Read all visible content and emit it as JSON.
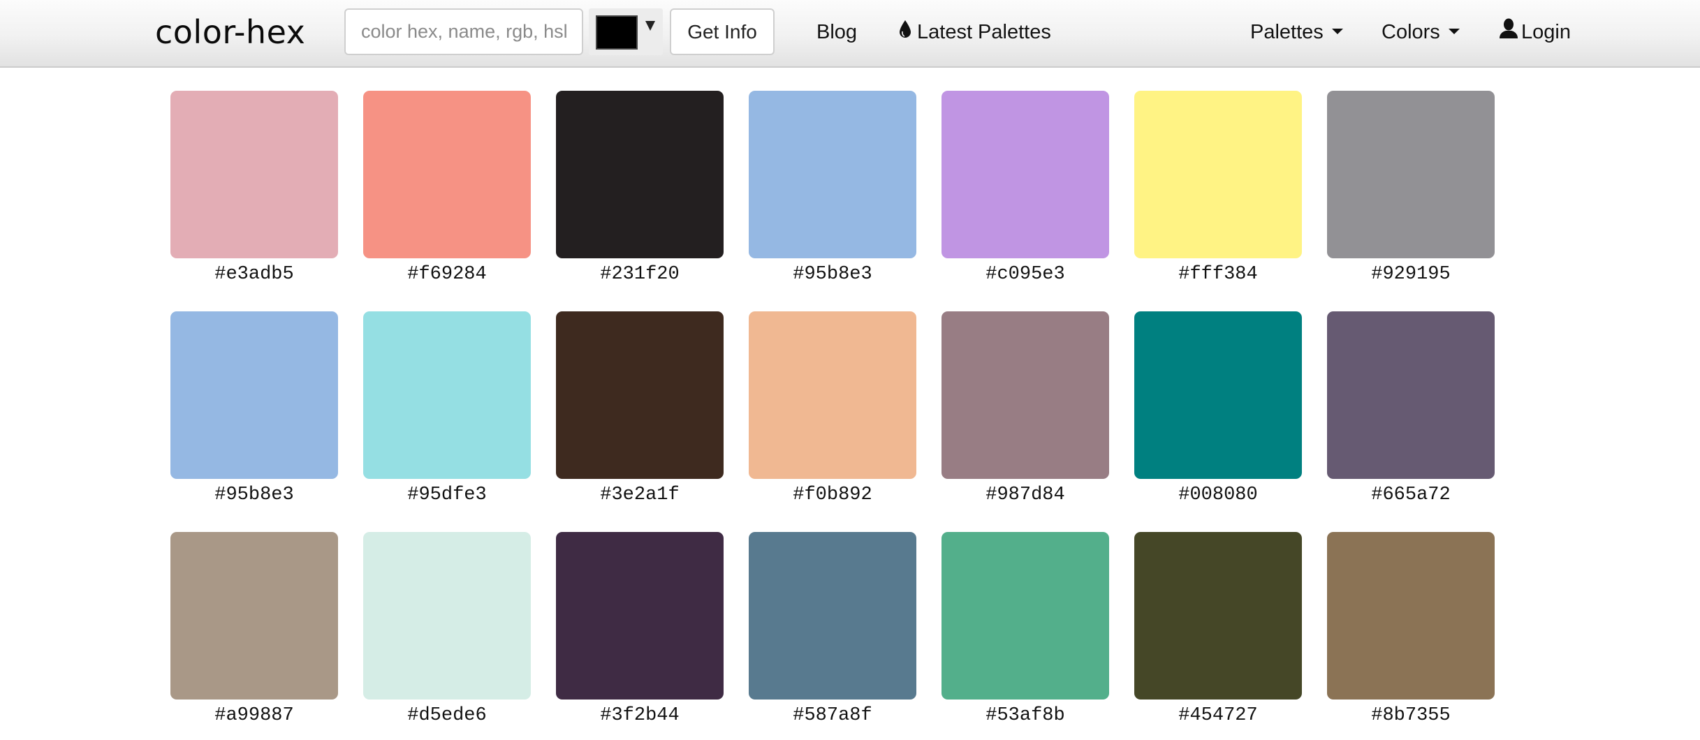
{
  "navbar": {
    "logo": "color-hex",
    "search": {
      "placeholder": "color hex, name, rgb, hsl",
      "value": ""
    },
    "color_picker": {
      "selected_color": "#000000",
      "icon": "caret-down-icon"
    },
    "get_info_label": "Get Info",
    "links": {
      "blog": "Blog",
      "latest_palettes": {
        "label": "Latest Palettes",
        "icon": "drop-icon"
      },
      "palettes": {
        "label": "Palettes",
        "icon": "caret-down-icon"
      },
      "colors": {
        "label": "Colors",
        "icon": "caret-down-icon"
      },
      "login": {
        "label": "Login",
        "icon": "user-icon"
      }
    }
  },
  "swatches": [
    {
      "hex": "#e3adb5",
      "label": "#e3adb5"
    },
    {
      "hex": "#f69284",
      "label": "#f69284"
    },
    {
      "hex": "#231f20",
      "label": "#231f20"
    },
    {
      "hex": "#95b8e3",
      "label": "#95b8e3"
    },
    {
      "hex": "#c095e3",
      "label": "#c095e3"
    },
    {
      "hex": "#fff384",
      "label": "#fff384"
    },
    {
      "hex": "#929195",
      "label": "#929195"
    },
    {
      "hex": "#95b8e3",
      "label": "#95b8e3"
    },
    {
      "hex": "#95dfe3",
      "label": "#95dfe3"
    },
    {
      "hex": "#3e2a1f",
      "label": "#3e2a1f"
    },
    {
      "hex": "#f0b892",
      "label": "#f0b892"
    },
    {
      "hex": "#987d84",
      "label": "#987d84"
    },
    {
      "hex": "#008080",
      "label": "#008080"
    },
    {
      "hex": "#665a72",
      "label": "#665a72"
    },
    {
      "hex": "#a99887",
      "label": "#a99887"
    },
    {
      "hex": "#d5ede6",
      "label": "#d5ede6"
    },
    {
      "hex": "#3f2b44",
      "label": "#3f2b44"
    },
    {
      "hex": "#587a8f",
      "label": "#587a8f"
    },
    {
      "hex": "#53af8b",
      "label": "#53af8b"
    },
    {
      "hex": "#454727",
      "label": "#454727"
    },
    {
      "hex": "#8b7355",
      "label": "#8b7355"
    }
  ]
}
